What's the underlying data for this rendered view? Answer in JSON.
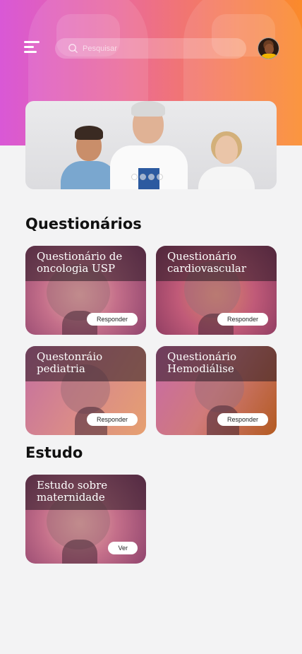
{
  "search": {
    "placeholder": "Pesquisar"
  },
  "sections": {
    "questionarios_title": "Questionários",
    "estudo_title": "Estudo"
  },
  "questionarios": [
    {
      "title": "Questionário de oncologia USP",
      "button": "Responder"
    },
    {
      "title": "Questionário cardiovascular",
      "button": "Responder"
    },
    {
      "title": "Questonráio pediatria",
      "button": "Responder"
    },
    {
      "title": "Questionário Hemodiálise",
      "button": "Responder"
    }
  ],
  "estudo": [
    {
      "title": "Estudo sobre maternidade",
      "button": "Ver"
    }
  ],
  "carousel": {
    "count": 4,
    "active_index": 0
  },
  "colors": {
    "gradient_start": "#d958d6",
    "gradient_end": "#fb8a2a"
  }
}
